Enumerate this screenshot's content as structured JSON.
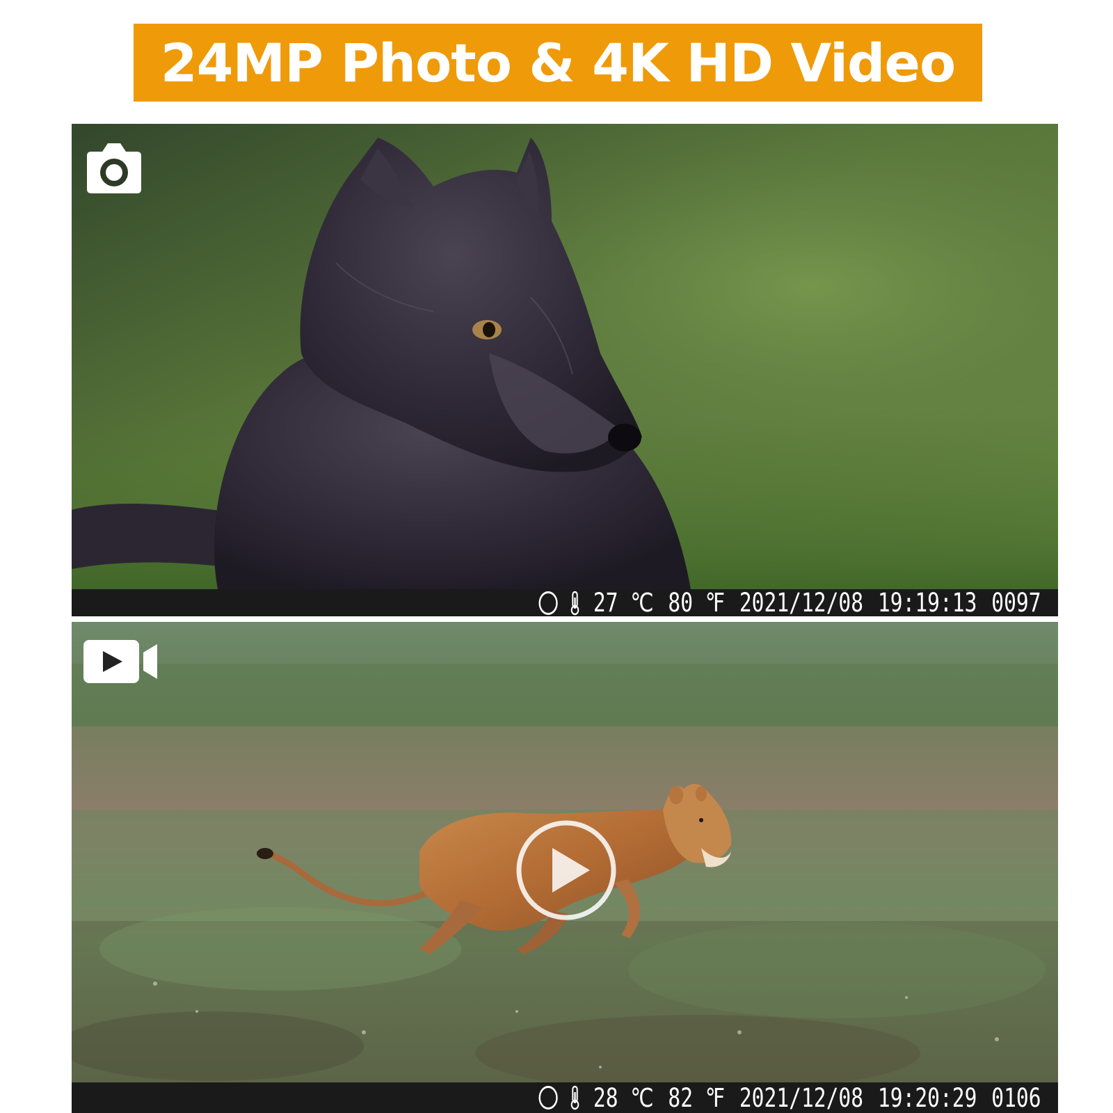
{
  "banner": {
    "title": "24MP Photo & 4K HD Video",
    "color": "#ef9a09"
  },
  "photo_panel": {
    "mode_icon": "camera-icon",
    "subject": "arctic-fox-photo",
    "info": {
      "temp_c": "27 ℃",
      "temp_f": "80 ℉",
      "date": "2021/12/08",
      "time": "19:19:13",
      "index": "0097"
    }
  },
  "video_panel": {
    "mode_icon": "video-camera-icon",
    "subject": "lioness-running-video",
    "overlay_icon": "play-icon",
    "info": {
      "temp_c": "28 ℃",
      "temp_f": "82 ℉",
      "date": "2021/12/08",
      "time": "19:20:29",
      "index": "0106"
    }
  }
}
